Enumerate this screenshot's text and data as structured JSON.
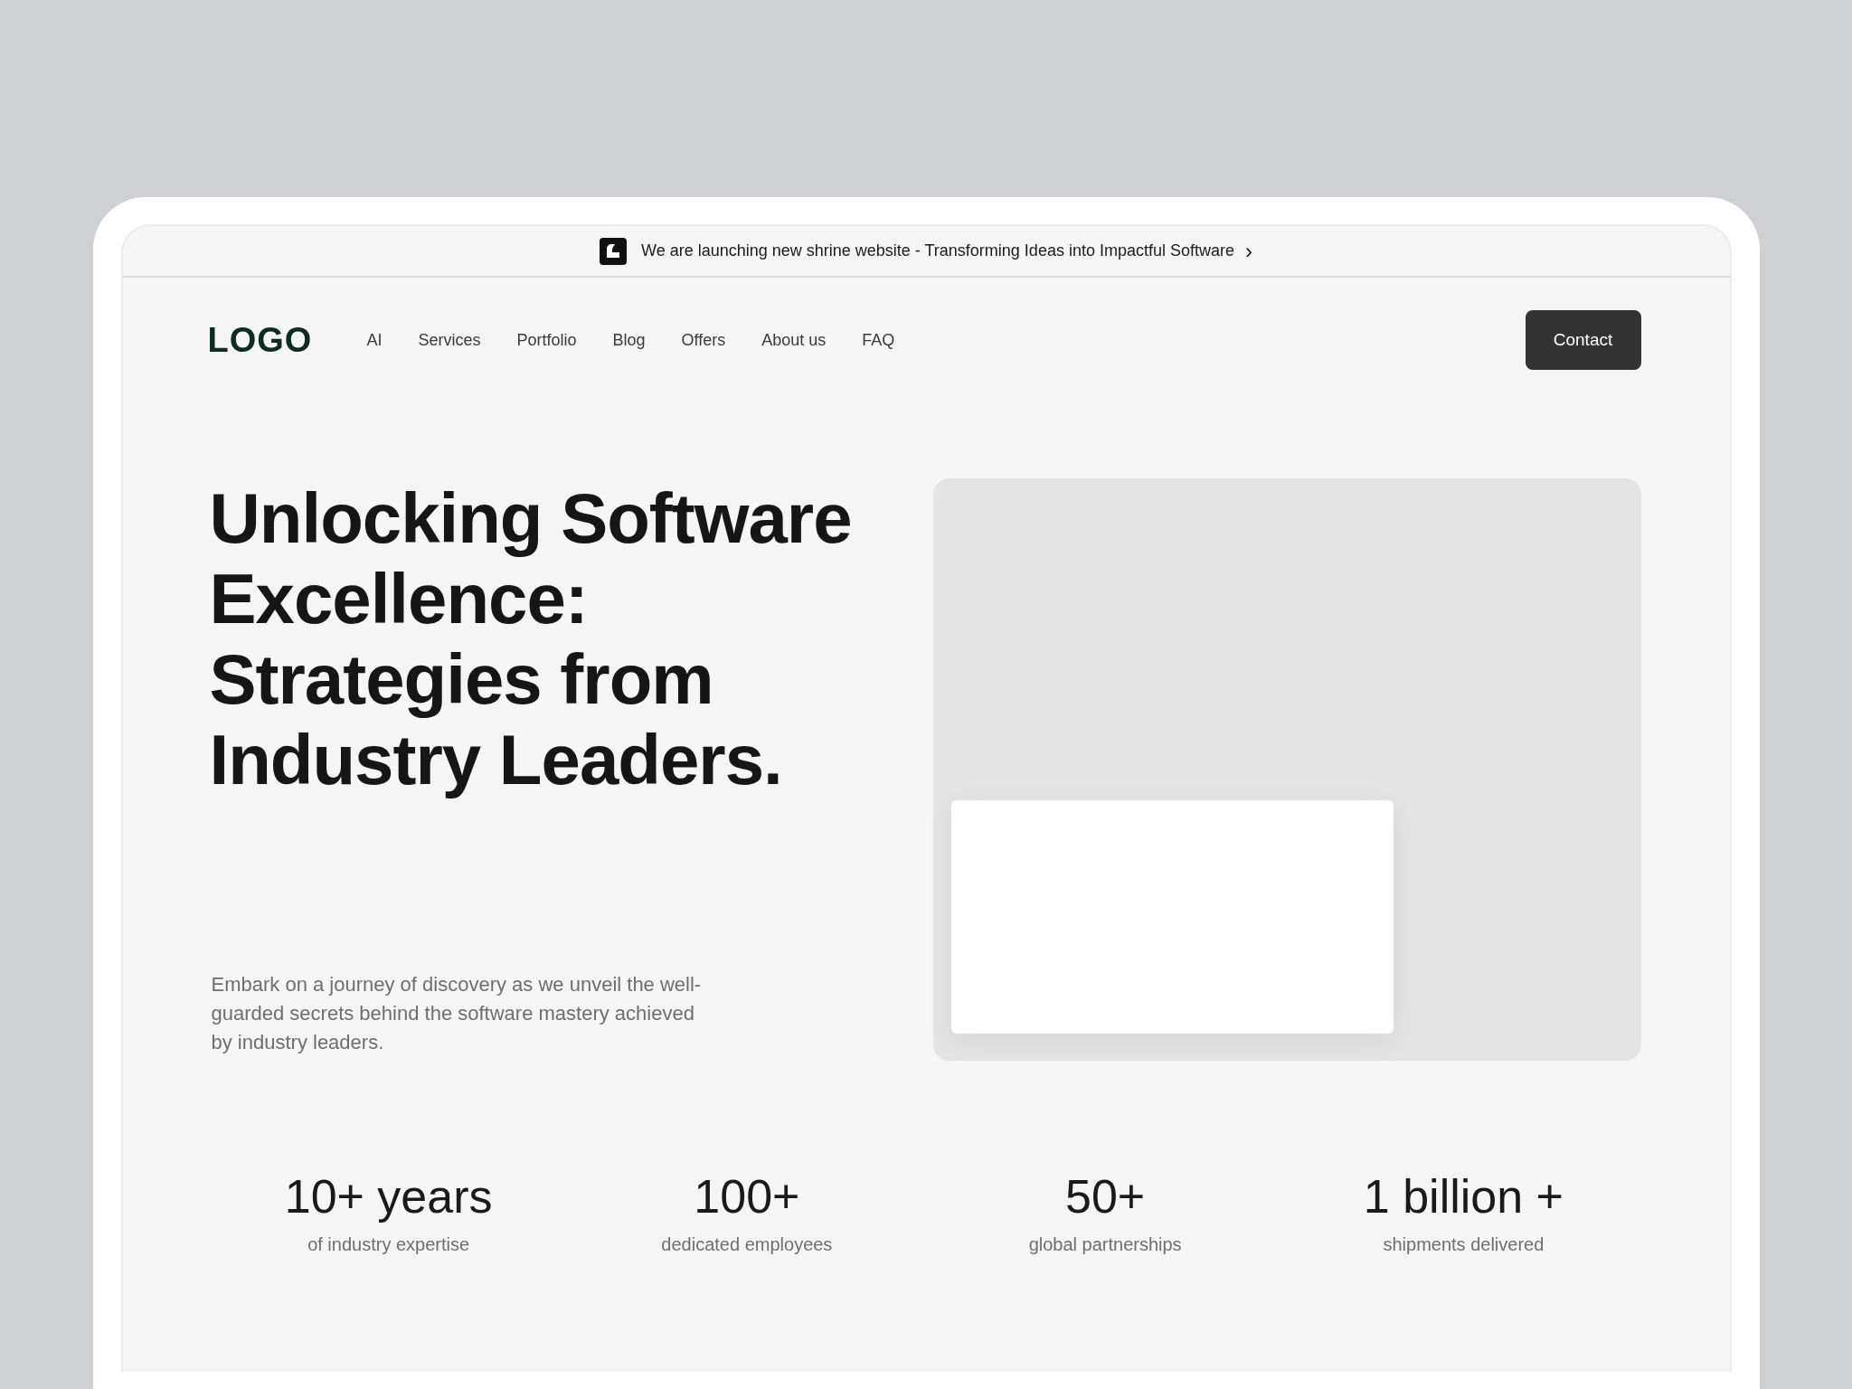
{
  "announcement": {
    "text": "We are launching new shrine website - Transforming Ideas into Impactful Software",
    "chevron": "›"
  },
  "nav": {
    "logo": "LOGO",
    "links": [
      "AI",
      "Services",
      "Portfolio",
      "Blog",
      "Offers",
      "About us",
      "FAQ"
    ],
    "cta": "Contact"
  },
  "hero": {
    "heading": "Unlocking Software Excellence: Strategies from Industry Leaders.",
    "description": "Embark on a journey of discovery as we unveil the well-guarded secrets behind the software mastery achieved by industry leaders."
  },
  "stats": [
    {
      "value": "10+ years",
      "label": "of industry expertise"
    },
    {
      "value": "100+",
      "label": "dedicated employees"
    },
    {
      "value": "50+",
      "label": "global partnerships"
    },
    {
      "value": "1 billion +",
      "label": "shipments delivered"
    }
  ]
}
